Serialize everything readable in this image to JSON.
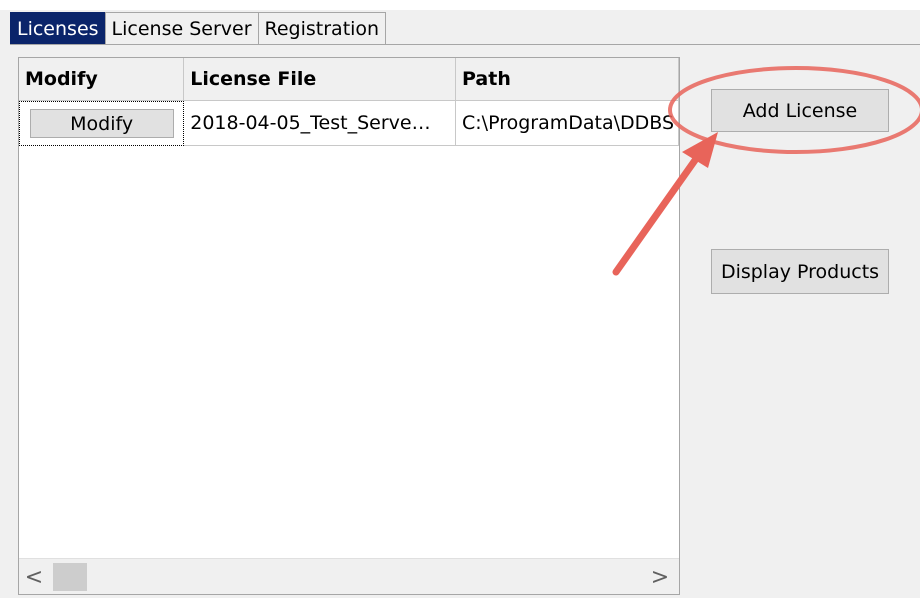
{
  "tabs": [
    {
      "label": "Licenses",
      "active": true
    },
    {
      "label": "License Server",
      "active": false
    },
    {
      "label": "Registration",
      "active": false
    }
  ],
  "grid": {
    "columns": [
      "Modify",
      "License File",
      "Path"
    ],
    "rows": [
      {
        "modify_label": "Modify",
        "license_file": "2018-04-05_Test_Serve…",
        "path": "C:\\ProgramData\\DDBS"
      }
    ]
  },
  "scroll": {
    "left_arrow": "<",
    "right_arrow": ">"
  },
  "buttons": {
    "add_license": "Add License",
    "display_products": "Display Products"
  },
  "annotation_color": "#e8645a",
  "selection_color": "#0a246a"
}
